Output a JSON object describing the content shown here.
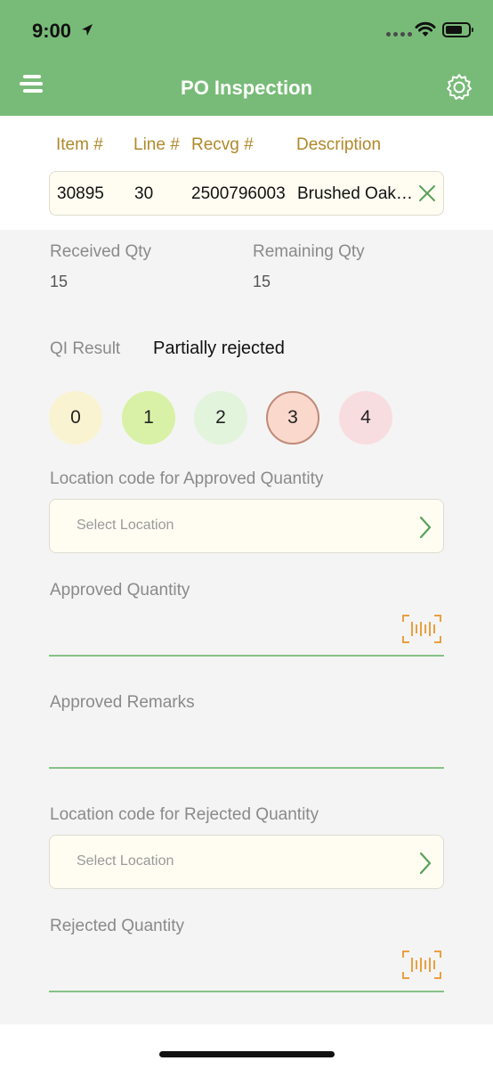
{
  "status_bar": {
    "time": "9:00"
  },
  "header": {
    "title": "PO Inspection"
  },
  "item_table": {
    "columns": [
      "Item #",
      "Line #",
      "Recvg #",
      "Description"
    ],
    "row": {
      "item": "30895",
      "line": "30",
      "recvg": "2500796003",
      "description": "Brushed Oak…"
    }
  },
  "quantities": {
    "received_label": "Received Qty",
    "received_value": "15",
    "remaining_label": "Remaining Qty",
    "remaining_value": "15"
  },
  "qi_result": {
    "label": "QI Result",
    "value": "Partially rejected",
    "options": [
      "0",
      "1",
      "2",
      "3",
      "4"
    ],
    "selected": "3"
  },
  "approved_location": {
    "label": "Location code for Approved Quantity",
    "placeholder": "Select Location"
  },
  "approved_quantity": {
    "label": "Approved Quantity",
    "value": ""
  },
  "approved_remarks": {
    "label": "Approved Remarks",
    "value": ""
  },
  "rejected_location": {
    "label": "Location code for Rejected Quantity",
    "placeholder": "Select Location"
  },
  "rejected_quantity": {
    "label": "Rejected Quantity",
    "value": ""
  },
  "colors": {
    "header": "#78bb78",
    "column_header": "#b0882a",
    "accent_green": "#5aa05a",
    "scan_icon": "#e8a040",
    "circle_0": "#faf3d2",
    "circle_1": "#d8f1a6",
    "circle_2": "#e2f4dc",
    "circle_3": "#fbd8cc",
    "circle_4": "#f8dde0"
  }
}
